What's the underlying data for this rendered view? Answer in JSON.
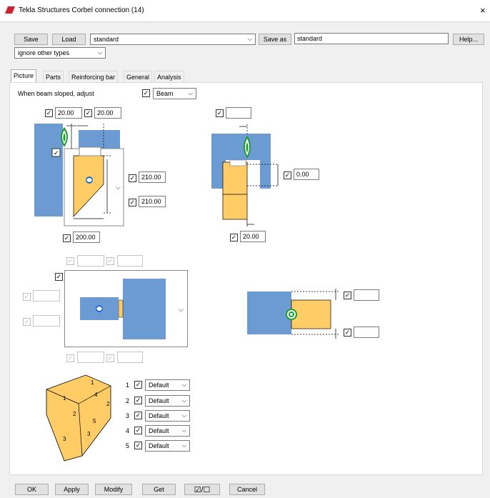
{
  "window": {
    "title": "Tekla Structures  Corbel connection (14)",
    "close": "×"
  },
  "toolbar": {
    "save": "Save",
    "load": "Load",
    "load_value": "standard",
    "save_as": "Save as",
    "save_as_value": "standard",
    "help": "Help...",
    "filter_value": "ignore other types"
  },
  "tabs": [
    {
      "label": "Picture"
    },
    {
      "label": "Parts"
    },
    {
      "label": "Reinforcing bar"
    },
    {
      "label": "General"
    },
    {
      "label": "Analysis"
    }
  ],
  "picture": {
    "sloped_label": "When beam sloped, adjust",
    "sloped_value": "Beam",
    "top_left_1": "20.00",
    "top_left_2": "20.00",
    "mid_1": "210.00",
    "mid_2": "210.00",
    "bottom_1": "200.00",
    "right_top": "",
    "right_mid": "0.00",
    "right_bottom": "20.00",
    "legend": [
      {
        "num": "1",
        "value": "Default"
      },
      {
        "num": "2",
        "value": "Default"
      },
      {
        "num": "3",
        "value": "Default"
      },
      {
        "num": "4",
        "value": "Default"
      },
      {
        "num": "5",
        "value": "Default"
      }
    ],
    "shape_labels": [
      "1",
      "4",
      "1",
      "2",
      "2",
      "5",
      "3",
      "3"
    ]
  },
  "bottom": {
    "ok": "OK",
    "apply": "Apply",
    "modify": "Modify",
    "get": "Get",
    "toggle": "☑/☐",
    "cancel": "Cancel"
  },
  "colors": {
    "steel_blue": "#6b9bd2",
    "corbel_yellow": "#ffcc66",
    "green": "#1a9e2f"
  }
}
